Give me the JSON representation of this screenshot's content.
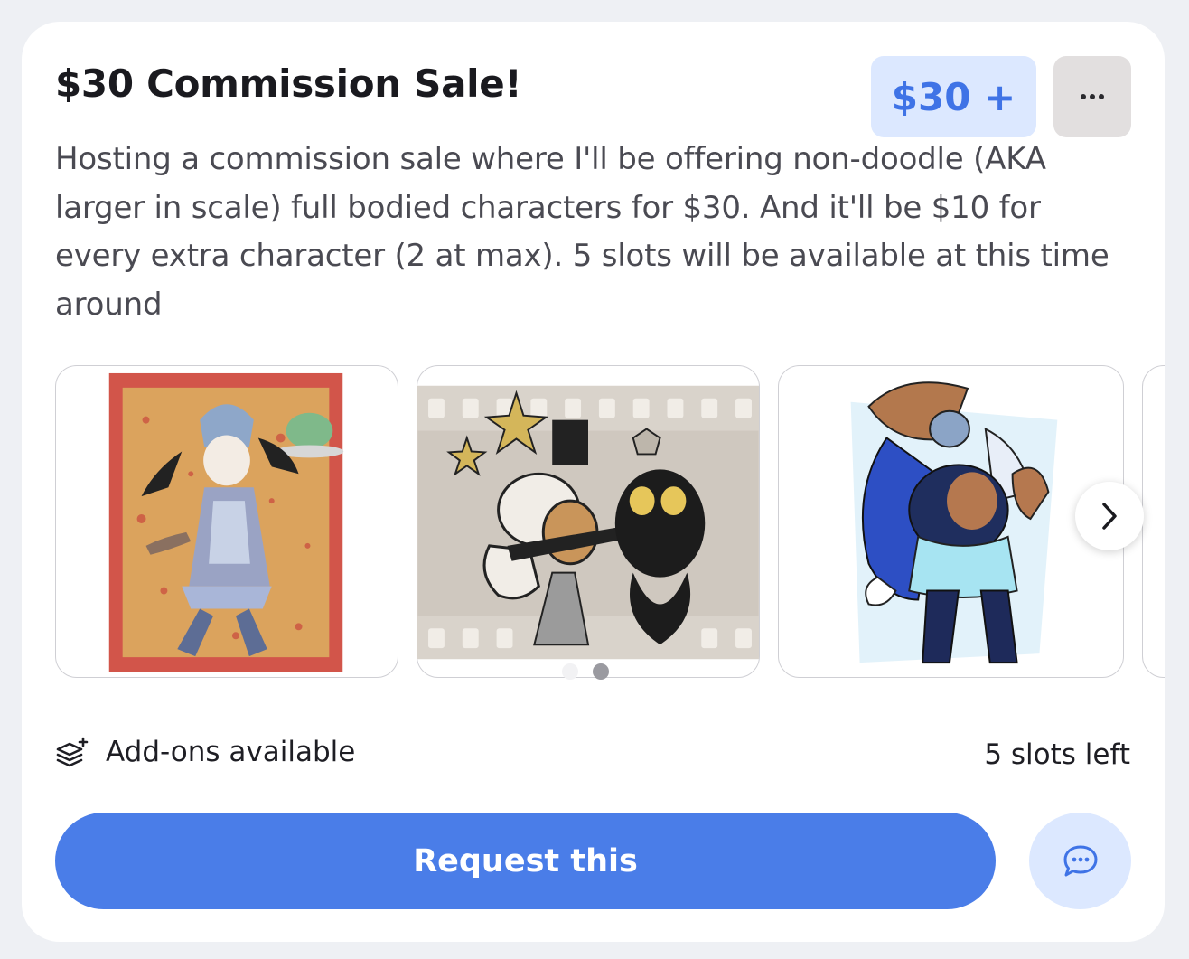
{
  "commission": {
    "title": "$30 Commission Sale!",
    "price": "$30 +",
    "description": "Hosting a commission sale where I'll be offering non-doodle (AKA larger in scale) full bodied characters for $30. And it'll be $10 for every extra character (2 at max). 5 slots will be available at this time around"
  },
  "gallery": {
    "images": [
      {
        "name": "maid-character-artwork"
      },
      {
        "name": "film-strip-characters-artwork"
      },
      {
        "name": "blue-armored-character-artwork"
      }
    ],
    "dots": 2,
    "active_dot": 1
  },
  "footer": {
    "addons_label": "Add-ons available",
    "slots_label": "5 slots left",
    "request_label": "Request this"
  },
  "icons": {
    "more": "more-horizontal-icon",
    "next": "chevron-right-icon",
    "addons": "layers-plus-icon",
    "chat": "chat-bubble-icon"
  },
  "colors": {
    "accent": "#4a7de8",
    "accent_light": "#dce8ff",
    "price_text": "#3f73e6"
  }
}
